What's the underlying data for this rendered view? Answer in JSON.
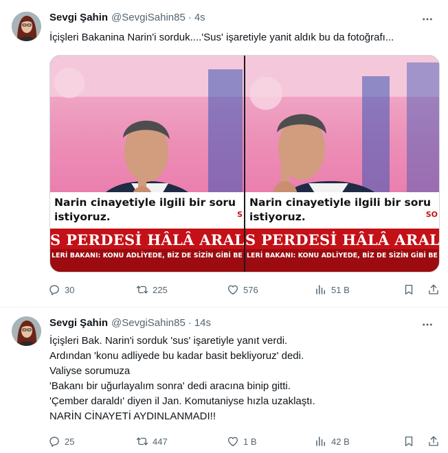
{
  "tweets": [
    {
      "author_name": "Sevgi Şahin",
      "handle": "@SevgiSahin85",
      "separator": "·",
      "time": "4s",
      "text": "İçişleri Bakanina Narin'i sorduk....'Sus' işaretiyle yanit aldık bu da fotoğrafı...",
      "media": {
        "caption_line1": "Narin cinayetiyle ilgili bir soru",
        "caption_line2": "istiyoruz.",
        "headline_left": "S PERDESİ HÂLÂ ARALANAI",
        "headline_right": "S PERDESİ HÂLÂ ARALANA",
        "ticker_left": "LERİ BAKANI: KONU ADLİYEDE, BİZ DE SİZİN GİBİ BE",
        "ticker_right": "LERİ BAKANI: KONU ADLİYEDE, BİZ DE SİZİN GİBİ BE",
        "corner_tag_left": "S",
        "corner_tag_right": "SO"
      },
      "actions": {
        "replies": "30",
        "reposts": "225",
        "likes": "576",
        "views": "51 B"
      }
    },
    {
      "author_name": "Sevgi Şahin",
      "handle": "@SevgiSahin85",
      "separator": "·",
      "time": "14s",
      "lines": [
        "İçişleri Bak. Narin'i sorduk  'sus' işaretiyle yanıt verdi.",
        "Ardından 'konu adliyede bu kadar basit bekliyoruz' dedi.",
        "Valiyse sorumuza",
        "'Bakanı bir uğurlayalım sonra' dedi aracına binip gitti.",
        "'Çember daraldı' diyen il Jan. Komutaniyse hızla uzaklaştı.",
        "NARİN CİNAYETİ AYDINLANMADI!!"
      ],
      "actions": {
        "replies": "25",
        "reposts": "447",
        "likes": "1 B",
        "views": "42 B"
      }
    }
  ],
  "icons": [
    "more-icon",
    "reply-icon",
    "repost-icon",
    "like-icon",
    "views-icon",
    "bookmark-icon",
    "share-icon"
  ],
  "colors": {
    "text_primary": "#0f1419",
    "text_secondary": "#536471",
    "divider": "#eff3f4",
    "news_red": "#c41017"
  }
}
